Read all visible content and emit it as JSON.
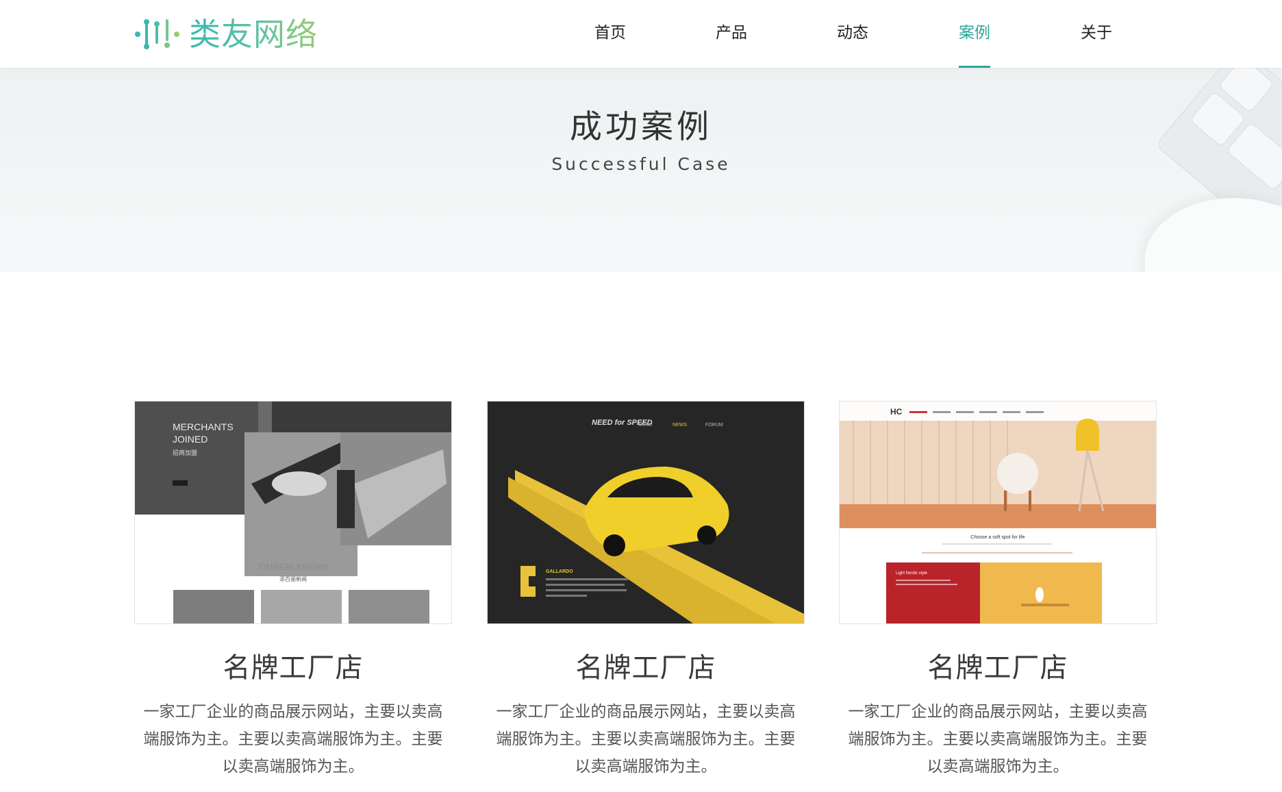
{
  "brand": {
    "name": "类友网络",
    "colors": {
      "teal": "#2aa59a",
      "green": "#9acb72"
    }
  },
  "nav": {
    "items": [
      {
        "label": "首页"
      },
      {
        "label": "产品"
      },
      {
        "label": "动态"
      },
      {
        "label": "案例"
      },
      {
        "label": "关于"
      }
    ],
    "active": "案例"
  },
  "banner": {
    "title": "成功案例",
    "subtitle": "Successful Case"
  },
  "cases": [
    {
      "title": "名牌工厂店",
      "desc": "一家工厂企业的商品展示网站，主要以卖高端服饰为主。主要以卖高端服饰为主。主要以卖高端服饰为主。",
      "thumb": {
        "text1": "MERCHANTS",
        "text2": "JOINED",
        "text3": "招商加盟",
        "text4": "TIMBERLYNEWS",
        "text5": "添百丽新闻"
      }
    },
    {
      "title": "名牌工厂店",
      "desc": "一家工厂企业的商品展示网站，主要以卖高端服饰为主。主要以卖高端服饰为主。主要以卖高端服饰为主。",
      "thumb": {
        "logo": "NEED for SPEED",
        "menu": [
          "MENU",
          "NEWS",
          "FORUM"
        ],
        "caption": "GALLARDO"
      }
    },
    {
      "title": "名牌工厂店",
      "desc": "一家工厂企业的商品展示网站，主要以卖高端服饰为主。主要以卖高端服饰为主。主要以卖高端服饰为主。",
      "thumb": {
        "logo": "HC",
        "tagline": "Choose a soft spot for life",
        "panel": "Light Nordic style"
      }
    }
  ]
}
